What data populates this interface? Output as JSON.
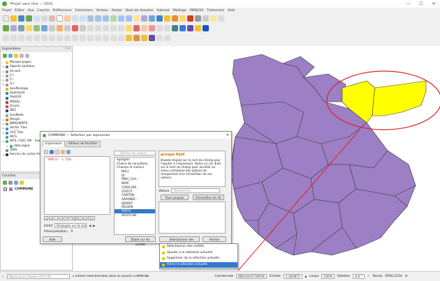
{
  "window": {
    "title": "*Projet sans titre — QGIS",
    "controls": [
      "—",
      "☐",
      "✕"
    ]
  },
  "menu": [
    "Projet",
    "Éditer",
    "Vue",
    "Couche",
    "Préférences",
    "Extensions",
    "Vecteur",
    "Raster",
    "Base de données",
    "Internet",
    "Maillage",
    "MMQGIS",
    "Traitement",
    "Aide"
  ],
  "browser": {
    "title": "Explorateur",
    "close": "☐✕",
    "items": [
      {
        "label": "Marque-pages",
        "arrow": "",
        "color": "#f2c700"
      },
      {
        "label": "Signets spatiaux",
        "arrow": "▸",
        "color": "#777"
      },
      {
        "label": "Accueil",
        "arrow": "▸",
        "color": "#888"
      },
      {
        "label": "C:\\",
        "arrow": "▸",
        "color": "#999"
      },
      {
        "label": "F:\\",
        "arrow": "▸",
        "color": "#999"
      },
      {
        "label": "G:\\",
        "arrow": "▸",
        "color": "#999"
      },
      {
        "label": "GeoPackage",
        "arrow": "",
        "color": "#d8b800"
      },
      {
        "label": "SpatiaLite",
        "arrow": "",
        "color": "#2a8bd8"
      },
      {
        "label": "PostGIS",
        "arrow": "",
        "color": "#336699"
      },
      {
        "label": "MSSQL",
        "arrow": "",
        "color": "#c0392b"
      },
      {
        "label": "Oracle",
        "arrow": "",
        "color": "#d44"
      },
      {
        "label": "DB2",
        "arrow": "",
        "color": "#444"
      },
      {
        "label": "GeoNode",
        "arrow": "",
        "color": "#7aa"
      },
      {
        "label": "Mergin",
        "arrow": "▸",
        "color": "#e07a00"
      },
      {
        "label": "WMS/WMTS",
        "arrow": "▸",
        "color": "#5a8"
      },
      {
        "label": "Vector Tiles",
        "arrow": "▸",
        "color": "#48c"
      },
      {
        "label": "XYZ Tiles",
        "arrow": "▸",
        "color": "#48c"
      },
      {
        "label": "WCS",
        "arrow": "",
        "color": "#4a8"
      },
      {
        "label": "WFS / OGC API - Features",
        "arrow": "▾",
        "color": "#4a8"
      },
      {
        "label": "data.sigea",
        "arrow": "▸",
        "color": "#4a8",
        "indent": true
      },
      {
        "label": "OWS",
        "arrow": "",
        "color": "#888"
      },
      {
        "label": "Service de cartes ArcGIS Rest",
        "arrow": "▸",
        "color": "#333"
      }
    ]
  },
  "layers": {
    "title": "Couches",
    "layer_name": "COMMUNE"
  },
  "dialog": {
    "title": "COMMUNE — Sélection par expression",
    "tabs": [
      "Expression",
      "Éditeur de fonction"
    ],
    "expression": "\"POP21\" < 550",
    "search_placeholder": "Afficher les valeurs",
    "search_label": "Rechercher...",
    "operators": [
      "=",
      "+",
      "-",
      "/",
      "*",
      "^",
      "||",
      "(",
      ")",
      "'\\n'"
    ],
    "entity_label": "Entité",
    "entity_value": "Ensoupes sur la Lan",
    "preview_label": "Prévisualisation :",
    "preview_value": "0",
    "function_tree": [
      {
        "label": "Agrégats",
        "type": "group"
      },
      {
        "label": "Chaîne de caractères",
        "type": "group"
      },
      {
        "label": "Champs et valeurs",
        "type": "group"
      },
      {
        "label": "NULL",
        "type": "sub"
      },
      {
        "label": "ID",
        "type": "sub"
      },
      {
        "label": "PREC_PLA...",
        "type": "sub"
      },
      {
        "label": "NOM",
        "type": "sub"
      },
      {
        "label": "CODE_INS...",
        "type": "sub"
      },
      {
        "label": "STATUT",
        "type": "sub"
      },
      {
        "label": "CANTON",
        "type": "sub"
      },
      {
        "label": "ARRONDI...",
        "type": "sub"
      },
      {
        "label": "DEPART",
        "type": "sub"
      },
      {
        "label": "REGION",
        "type": "sub"
      },
      {
        "label": "POP21",
        "type": "sub",
        "selected": true
      },
      {
        "label": "MULTICAN",
        "type": "sub"
      }
    ],
    "help": {
      "heading": "groupe field",
      "text": "Double-cliquez sur le nom du champ pour l'ajouter à l'expression. Faites un clic droit sur le nom du champ pour accéder au menu contextuel des options de chargement d'un échantillon de ces valeurs."
    },
    "values_label": "Valeurs",
    "btn_all": "Tous uniques",
    "btn_sample": "Échantillon de 10",
    "btn_help": "Aide",
    "btn_zoom": "Zoom sur les entités",
    "btn_select": "Sélectionner des entités",
    "btn_close": "Fermer"
  },
  "popup": {
    "items": [
      "Sélectionner des entités",
      "Ajouter à la sélection actuelle",
      "Supprimer de la sélection actuelle",
      "Filtrer la sélection actuelle"
    ],
    "selected_index": 3
  },
  "status": {
    "search_placeholder": "Tapez pour trouver (Ctrl+K)",
    "message": "2 entités sélectionnées dans la couche COMMUNE.",
    "coord_label": "Coordonnée",
    "coord_value": "685320,6730978",
    "scale_label": "Échelle",
    "scale_value": "1:303871",
    "zoom_label": "Loupe",
    "zoom_value": "100%",
    "rotation_label": "Rotation",
    "rotation_value": "0,0 °",
    "render_label": "Rendu",
    "crs": "EPSG:2154"
  },
  "map": {
    "fill": "#9c7fc4",
    "selected_fill": "#ffff00",
    "annotation_color": "#e02020"
  }
}
